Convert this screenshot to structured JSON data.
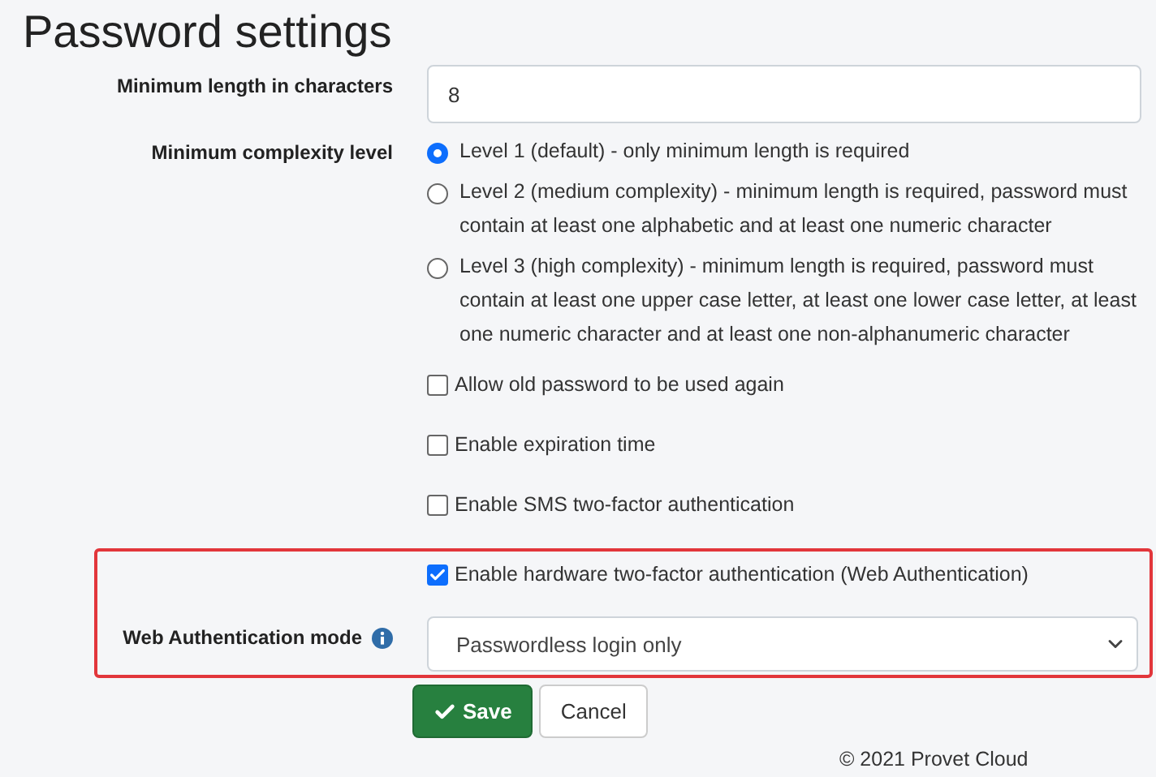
{
  "title": "Password settings",
  "min_length": {
    "label": "Minimum length in characters",
    "value": "8"
  },
  "complexity": {
    "label": "Minimum complexity level",
    "options": [
      {
        "text": "Level 1 (default) - only minimum length is required",
        "selected": true
      },
      {
        "text": "Level 2 (medium complexity) - minimum length is required, password must contain at least one alphabetic and at least one numeric character",
        "selected": false
      },
      {
        "text": "Level 3 (high complexity) - minimum length is required, password must contain at least one upper case letter, at least one lower case letter, at least one numeric character and at least one non-alphanumeric character",
        "selected": false
      }
    ]
  },
  "checkboxes": [
    {
      "label": "Allow old password to be used again",
      "checked": false
    },
    {
      "label": "Enable expiration time",
      "checked": false
    },
    {
      "label": "Enable SMS two-factor authentication",
      "checked": false
    }
  ],
  "highlighted_section": {
    "checkbox": {
      "label": "Enable hardware two-factor authentication (Web Authentication)",
      "checked": true
    },
    "webauthn_mode": {
      "label": "Web Authentication mode",
      "value": "Passwordless login only"
    }
  },
  "buttons": [
    {
      "label": "Save",
      "kind": "primary"
    },
    {
      "label": "Cancel",
      "kind": "secondary"
    }
  ],
  "footer": "© 2021 Provet Cloud"
}
